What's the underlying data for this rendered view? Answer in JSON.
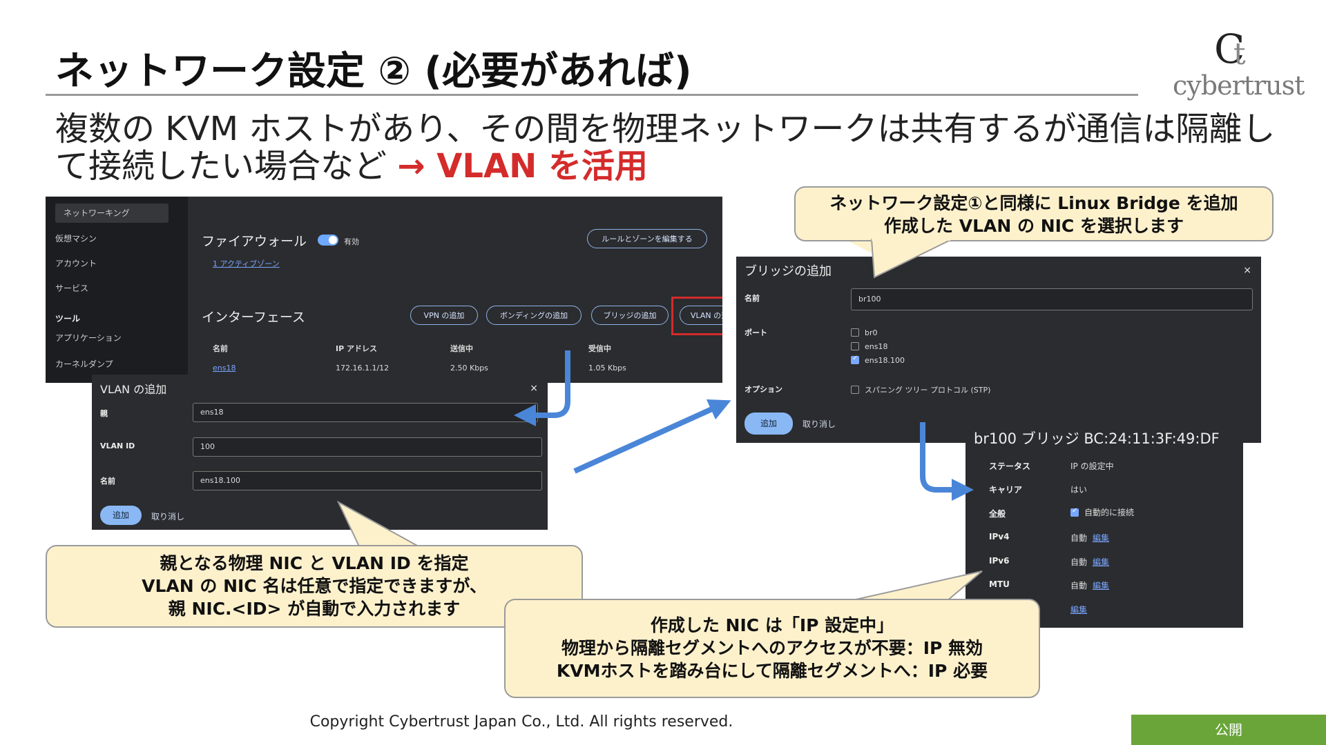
{
  "slide": {
    "title": "ネットワーク設定 ② (必要があれば)",
    "subtitle_line1": "複数の KVM ホストがあり、その間を物理ネットワークは共有するが通信は隔離し",
    "subtitle_line2": "て接続したい場合など",
    "subtitle_highlight": "→ VLAN を活用",
    "highlight_color": "#d42b2b"
  },
  "logo": {
    "mark": "C",
    "mark_t": "t",
    "text": "cybertrust"
  },
  "cockpit": {
    "sidebar": [
      "ネットワーキング",
      "仮想マシン",
      "アカウント",
      "サービス",
      "ツール",
      "アプリケーション",
      "カーネルダンプ"
    ],
    "firewall_heading": "ファイアウォール",
    "firewall_state": "有効",
    "firewall_zones_link": "1 アクティブゾーン",
    "edit_rules_button": "ルールとゾーンを編集する",
    "interfaces_heading": "インターフェース",
    "buttons": [
      "VPN の追加",
      "ボンディングの追加",
      "ブリッジの追加",
      "VLAN の追加"
    ],
    "columns": [
      "名前",
      "IP アドレス",
      "送信中",
      "受信中"
    ],
    "row": [
      "ens18",
      "172.16.1.1/12",
      "2.50 Kbps",
      "1.05 Kbps"
    ]
  },
  "vlan_dialog": {
    "title": "VLAN の追加",
    "close": "×",
    "parent_label": "親",
    "parent_value": "ens18",
    "vlanid_label": "VLAN ID",
    "vlanid_value": "100",
    "name_label": "名前",
    "name_value": "ens18.100",
    "add_button": "追加",
    "cancel_link": "取り消し"
  },
  "bridge_dialog": {
    "title": "ブリッジの追加",
    "close": "×",
    "name_label": "名前",
    "name_value": "br100",
    "ports_label": "ポート",
    "ports": [
      {
        "name": "br0",
        "checked": false
      },
      {
        "name": "ens18",
        "checked": false
      },
      {
        "name": "ens18.100",
        "checked": true
      }
    ],
    "options_label": "オプション",
    "stp_option": "スパニング ツリー プロトコル (STP)",
    "add_button": "追加",
    "cancel_link": "取り消し"
  },
  "bridge_details": {
    "header": "br100 ブリッジ BC:24:11:3F:49:DF",
    "rows": [
      {
        "key": "ステータス",
        "value": "IP の設定中",
        "link": ""
      },
      {
        "key": "キャリア",
        "value": "はい",
        "link": ""
      },
      {
        "key": "全般",
        "value": "自動的に接続",
        "link": ""
      },
      {
        "key": "IPv4",
        "value": "自動",
        "link": "編集"
      },
      {
        "key": "IPv6",
        "value": "自動",
        "link": "編集"
      },
      {
        "key": "MTU",
        "value": "自動",
        "link": "編集"
      },
      {
        "key": "",
        "value": "",
        "link": "編集"
      }
    ]
  },
  "callouts": {
    "top_right": [
      "ネットワーク設定①と同様に Linux Bridge を追加",
      "作成した VLAN の NIC を選択します"
    ],
    "bottom_left": [
      "親となる物理 NIC と VLAN ID を指定",
      "VLAN の NIC 名は任意で指定できますが、",
      "親 NIC.<ID> が自動で入力されます"
    ],
    "bottom_center": [
      "作成した NIC は「IP 設定中」",
      "物理から隔離セグメントへのアクセスが不要：IP 無効",
      "KVMホストを踏み台にして隔離セグメントへ：IP 必要"
    ]
  },
  "footer": {
    "copyright": "Copyright Cybertrust Japan Co., Ltd. All rights reserved.",
    "classification": "公開",
    "classification_color": "#6aa53a"
  },
  "colors": {
    "arrow": "#4a86d8",
    "callout_bg": "#fdf1cc",
    "dark_panel": "#2b2c2f"
  }
}
